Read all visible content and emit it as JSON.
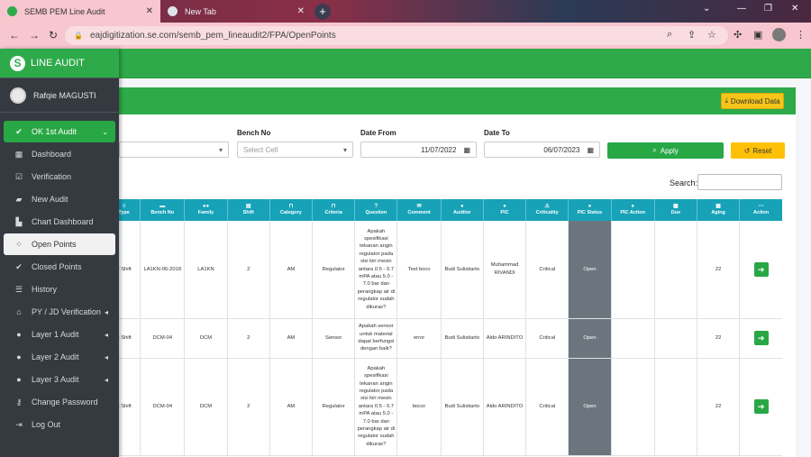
{
  "browser": {
    "tabs": [
      {
        "title": "SEMB PEM Line Audit",
        "active": true
      },
      {
        "title": "New Tab",
        "active": false
      }
    ],
    "url": "eajdigitization.se.com/semb_pem_lineaudit2/FPA/OpenPoints"
  },
  "sidebar": {
    "brand": "LINE AUDIT",
    "user": "Rafqie MAGUSTI",
    "items": [
      {
        "label": "OK 1st Audit",
        "icon": "check-icon",
        "state": "highlight"
      },
      {
        "label": "Dashboard",
        "icon": "grid-icon"
      },
      {
        "label": "Verification",
        "icon": "check-square-icon"
      },
      {
        "label": "New Audit",
        "icon": "folder-plus-icon"
      },
      {
        "label": "Chart Dashboard",
        "icon": "chart-icon"
      },
      {
        "label": "Open Points",
        "icon": "spinner-icon",
        "state": "current"
      },
      {
        "label": "Closed Points",
        "icon": "check-circle-icon"
      },
      {
        "label": "History",
        "icon": "list-icon"
      },
      {
        "label": "PY / JD Verification",
        "icon": "tag-icon",
        "caret": true
      },
      {
        "label": "Layer 1 Audit",
        "icon": "user-icon",
        "caret": true
      },
      {
        "label": "Layer 2 Audit",
        "icon": "user-icon",
        "caret": true
      },
      {
        "label": "Layer 3 Audit",
        "icon": "user-icon",
        "caret": true
      },
      {
        "label": "Change Password",
        "icon": "key-icon"
      },
      {
        "label": "Log Out",
        "icon": "logout-icon"
      }
    ]
  },
  "toolbar": {
    "download_label": "Download Data"
  },
  "filters": {
    "bench_label": "Bench No",
    "bench_placeholder": "Select Cell",
    "date_from_label": "Date From",
    "date_from": "11/07/2022",
    "date_to_label": "Date To",
    "date_to": "06/07/2023",
    "apply_label": "Apply",
    "reset_label": "Reset",
    "search_label": "Search:"
  },
  "table": {
    "headers": [
      "Type",
      "Bench No",
      "Family",
      "Shift",
      "Category",
      "Criteria",
      "Question",
      "Comment",
      "Auditor",
      "PIC",
      "Criticality",
      "PIC Status",
      "PIC Action",
      "Due",
      "Aging",
      "Action"
    ],
    "rows": [
      {
        "type": "e Shift",
        "bench": "LA1KN-06-2018",
        "family": "LA1KN",
        "shift": "2",
        "category": "AM",
        "criteria": "Regulator",
        "question": "Apakah spesifikasi tekanan angin regulator pada sisi kiri mesin antara 0.5 - 0.7 mPA atau 5.0 - 7.0 bar dan perangkap air di regulator sudah dikuras?",
        "comment": "Test boco",
        "auditor": "Budi Sulistiarto",
        "pic": "Muhammad RIVANDI",
        "criticality": "Critical",
        "status": "Open",
        "pic_action": "",
        "due": "",
        "aging": "22"
      },
      {
        "type": "e Shift",
        "bench": "DCM-04",
        "family": "DCM",
        "shift": "2",
        "category": "AM",
        "criteria": "Sensor",
        "question": "Apakah sensor untuk material dapat berfungsi dengan baik?",
        "comment": "error",
        "auditor": "Budi Sulistiarto",
        "pic": "Aldo ARINDITO",
        "criticality": "Critical",
        "status": "Open",
        "pic_action": "",
        "due": "",
        "aging": "22"
      },
      {
        "type": "e Shift",
        "bench": "DCM-04",
        "family": "DCM",
        "shift": "2",
        "category": "AM",
        "criteria": "Regulator",
        "question": "Apakah spesifikasi tekanan angin regulator pada sisi kiri mesin antara 0.5 - 0.7 mPA atau 5.0 - 7.0 bar dan perangkap air di regulator sudah dikuras?",
        "comment": "bocor",
        "auditor": "Budi Sulistiarto",
        "pic": "Aldo ARINDITO",
        "criticality": "Critical",
        "status": "Open",
        "pic_action": "",
        "due": "",
        "aging": "22"
      }
    ]
  },
  "colors": {
    "brand_green": "#2eaa4a",
    "table_header": "#17a2b8",
    "sidebar": "#343a40",
    "status_bg": "#6c757d",
    "reset_yellow": "#ffc107"
  }
}
